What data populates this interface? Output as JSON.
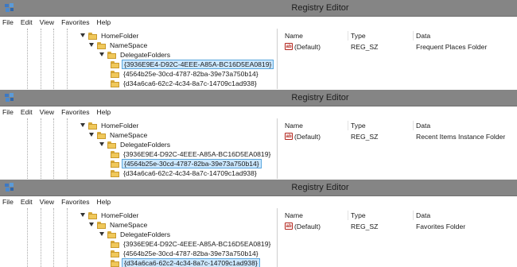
{
  "windows": [
    {
      "title": "Registry Editor",
      "menu": [
        "File",
        "Edit",
        "View",
        "Favorites",
        "Help"
      ],
      "tree": {
        "home_folder": "HomeFolder",
        "namespace": "NameSpace",
        "delegate_folders": "DelegateFolders",
        "keys": [
          "{3936E9E4-D92C-4EEE-A85A-BC16D5EA0819}",
          "{4564b25e-30cd-4787-82ba-39e73a750b14}",
          "{d34a6ca6-62c2-4c34-8a7c-14709c1ad938}"
        ],
        "selected_index": 0
      },
      "columns": {
        "name": "Name",
        "type": "Type",
        "data": "Data"
      },
      "value": {
        "icon": "ab",
        "name": "(Default)",
        "type": "REG_SZ",
        "data": "Frequent Places Folder"
      }
    },
    {
      "title": "Registry Editor",
      "menu": [
        "File",
        "Edit",
        "View",
        "Favorites",
        "Help"
      ],
      "tree": {
        "home_folder": "HomeFolder",
        "namespace": "NameSpace",
        "delegate_folders": "DelegateFolders",
        "keys": [
          "{3936E9E4-D92C-4EEE-A85A-BC16D5EA0819}",
          "{4564b25e-30cd-4787-82ba-39e73a750b14}",
          "{d34a6ca6-62c2-4c34-8a7c-14709c1ad938}"
        ],
        "selected_index": 1
      },
      "columns": {
        "name": "Name",
        "type": "Type",
        "data": "Data"
      },
      "value": {
        "icon": "ab",
        "name": "(Default)",
        "type": "REG_SZ",
        "data": "Recent Items Instance Folder"
      }
    },
    {
      "title": "Registry Editor",
      "menu": [
        "File",
        "Edit",
        "View",
        "Favorites",
        "Help"
      ],
      "tree": {
        "home_folder": "HomeFolder",
        "namespace": "NameSpace",
        "delegate_folders": "DelegateFolders",
        "keys": [
          "{3936E9E4-D92C-4EEE-A85A-BC16D5EA0819}",
          "{4564b25e-30cd-4787-82ba-39e73a750b14}",
          "{d34a6ca6-62c2-4c34-8a7c-14709c1ad938}"
        ],
        "selected_index": 2
      },
      "columns": {
        "name": "Name",
        "type": "Type",
        "data": "Data"
      },
      "value": {
        "icon": "ab",
        "name": "(Default)",
        "type": "REG_SZ",
        "data": "Favorites Folder"
      }
    }
  ]
}
